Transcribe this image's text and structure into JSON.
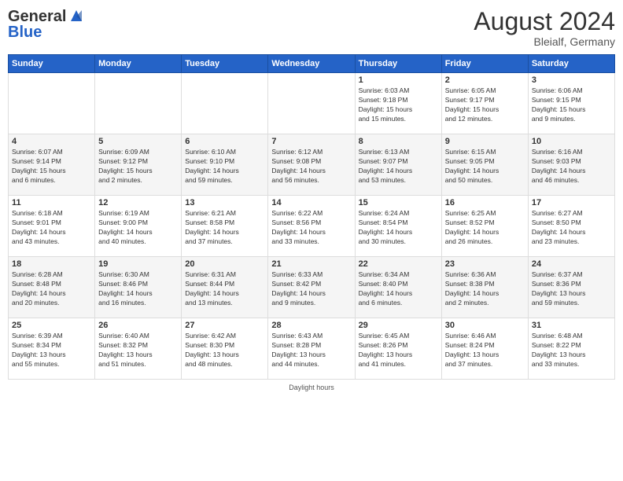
{
  "header": {
    "logo_general": "General",
    "logo_blue": "Blue",
    "month_year": "August 2024",
    "location": "Bleialf, Germany"
  },
  "days_of_week": [
    "Sunday",
    "Monday",
    "Tuesday",
    "Wednesday",
    "Thursday",
    "Friday",
    "Saturday"
  ],
  "footer_text": "Daylight hours",
  "weeks": [
    [
      {
        "day": "",
        "info": ""
      },
      {
        "day": "",
        "info": ""
      },
      {
        "day": "",
        "info": ""
      },
      {
        "day": "",
        "info": ""
      },
      {
        "day": "1",
        "info": "Sunrise: 6:03 AM\nSunset: 9:18 PM\nDaylight: 15 hours\nand 15 minutes."
      },
      {
        "day": "2",
        "info": "Sunrise: 6:05 AM\nSunset: 9:17 PM\nDaylight: 15 hours\nand 12 minutes."
      },
      {
        "day": "3",
        "info": "Sunrise: 6:06 AM\nSunset: 9:15 PM\nDaylight: 15 hours\nand 9 minutes."
      }
    ],
    [
      {
        "day": "4",
        "info": "Sunrise: 6:07 AM\nSunset: 9:14 PM\nDaylight: 15 hours\nand 6 minutes."
      },
      {
        "day": "5",
        "info": "Sunrise: 6:09 AM\nSunset: 9:12 PM\nDaylight: 15 hours\nand 2 minutes."
      },
      {
        "day": "6",
        "info": "Sunrise: 6:10 AM\nSunset: 9:10 PM\nDaylight: 14 hours\nand 59 minutes."
      },
      {
        "day": "7",
        "info": "Sunrise: 6:12 AM\nSunset: 9:08 PM\nDaylight: 14 hours\nand 56 minutes."
      },
      {
        "day": "8",
        "info": "Sunrise: 6:13 AM\nSunset: 9:07 PM\nDaylight: 14 hours\nand 53 minutes."
      },
      {
        "day": "9",
        "info": "Sunrise: 6:15 AM\nSunset: 9:05 PM\nDaylight: 14 hours\nand 50 minutes."
      },
      {
        "day": "10",
        "info": "Sunrise: 6:16 AM\nSunset: 9:03 PM\nDaylight: 14 hours\nand 46 minutes."
      }
    ],
    [
      {
        "day": "11",
        "info": "Sunrise: 6:18 AM\nSunset: 9:01 PM\nDaylight: 14 hours\nand 43 minutes."
      },
      {
        "day": "12",
        "info": "Sunrise: 6:19 AM\nSunset: 9:00 PM\nDaylight: 14 hours\nand 40 minutes."
      },
      {
        "day": "13",
        "info": "Sunrise: 6:21 AM\nSunset: 8:58 PM\nDaylight: 14 hours\nand 37 minutes."
      },
      {
        "day": "14",
        "info": "Sunrise: 6:22 AM\nSunset: 8:56 PM\nDaylight: 14 hours\nand 33 minutes."
      },
      {
        "day": "15",
        "info": "Sunrise: 6:24 AM\nSunset: 8:54 PM\nDaylight: 14 hours\nand 30 minutes."
      },
      {
        "day": "16",
        "info": "Sunrise: 6:25 AM\nSunset: 8:52 PM\nDaylight: 14 hours\nand 26 minutes."
      },
      {
        "day": "17",
        "info": "Sunrise: 6:27 AM\nSunset: 8:50 PM\nDaylight: 14 hours\nand 23 minutes."
      }
    ],
    [
      {
        "day": "18",
        "info": "Sunrise: 6:28 AM\nSunset: 8:48 PM\nDaylight: 14 hours\nand 20 minutes."
      },
      {
        "day": "19",
        "info": "Sunrise: 6:30 AM\nSunset: 8:46 PM\nDaylight: 14 hours\nand 16 minutes."
      },
      {
        "day": "20",
        "info": "Sunrise: 6:31 AM\nSunset: 8:44 PM\nDaylight: 14 hours\nand 13 minutes."
      },
      {
        "day": "21",
        "info": "Sunrise: 6:33 AM\nSunset: 8:42 PM\nDaylight: 14 hours\nand 9 minutes."
      },
      {
        "day": "22",
        "info": "Sunrise: 6:34 AM\nSunset: 8:40 PM\nDaylight: 14 hours\nand 6 minutes."
      },
      {
        "day": "23",
        "info": "Sunrise: 6:36 AM\nSunset: 8:38 PM\nDaylight: 14 hours\nand 2 minutes."
      },
      {
        "day": "24",
        "info": "Sunrise: 6:37 AM\nSunset: 8:36 PM\nDaylight: 13 hours\nand 59 minutes."
      }
    ],
    [
      {
        "day": "25",
        "info": "Sunrise: 6:39 AM\nSunset: 8:34 PM\nDaylight: 13 hours\nand 55 minutes."
      },
      {
        "day": "26",
        "info": "Sunrise: 6:40 AM\nSunset: 8:32 PM\nDaylight: 13 hours\nand 51 minutes."
      },
      {
        "day": "27",
        "info": "Sunrise: 6:42 AM\nSunset: 8:30 PM\nDaylight: 13 hours\nand 48 minutes."
      },
      {
        "day": "28",
        "info": "Sunrise: 6:43 AM\nSunset: 8:28 PM\nDaylight: 13 hours\nand 44 minutes."
      },
      {
        "day": "29",
        "info": "Sunrise: 6:45 AM\nSunset: 8:26 PM\nDaylight: 13 hours\nand 41 minutes."
      },
      {
        "day": "30",
        "info": "Sunrise: 6:46 AM\nSunset: 8:24 PM\nDaylight: 13 hours\nand 37 minutes."
      },
      {
        "day": "31",
        "info": "Sunrise: 6:48 AM\nSunset: 8:22 PM\nDaylight: 13 hours\nand 33 minutes."
      }
    ]
  ]
}
